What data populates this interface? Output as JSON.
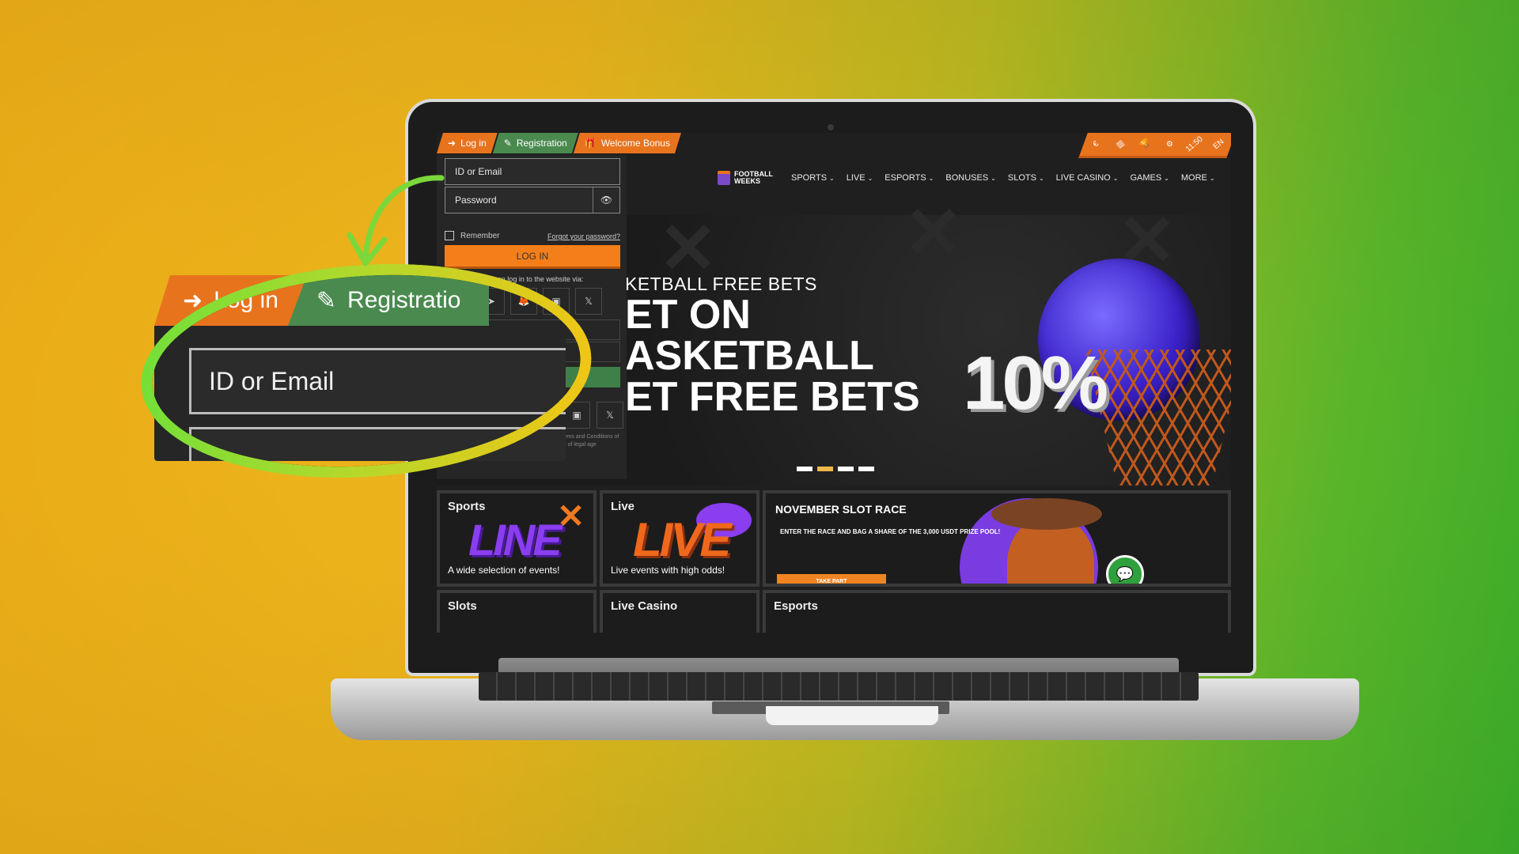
{
  "topbar": {
    "tabs": [
      {
        "label": "Log in",
        "icon": "login-icon"
      },
      {
        "label": "Registration",
        "icon": "edit-icon"
      },
      {
        "label": "Welcome Bonus",
        "icon": "gift-icon"
      }
    ],
    "right_tabs": [
      {
        "label": "€",
        "icon": "currency-icon"
      },
      {
        "label": "📊",
        "icon": "stats-icon"
      },
      {
        "label": "🏆",
        "icon": "trophy-icon"
      },
      {
        "label": "⚙",
        "icon": "settings-icon"
      },
      {
        "label": "11:50",
        "icon": "clock"
      },
      {
        "label": "EN",
        "icon": "language"
      }
    ]
  },
  "nav": {
    "logo_line1": "FOOTBALL",
    "logo_line2": "WEEKS",
    "items": [
      "SPORTS",
      "LIVE",
      "ESPORTS",
      "BONUSES",
      "SLOTS",
      "LIVE CASINO",
      "GAMES",
      "MORE"
    ]
  },
  "login": {
    "id_placeholder": "ID or Email",
    "password_placeholder": "Password",
    "remember_label": "Remember",
    "forgot_label": "Forgot your password?",
    "login_button": "LOG IN",
    "via_label": "You can log in to the website via:",
    "social": [
      "telegram",
      "metamask",
      "twitch",
      "x"
    ],
    "social_glyphs": [
      "➤",
      "🦊",
      "▣",
      "𝕏"
    ],
    "legal_text": "...you confirm that you have read and agree Terms and Conditions of the company and confirm that you are of legal age"
  },
  "hero": {
    "subtitle": "KETBALL FREE BETS",
    "title_line1": "ET ON",
    "title_line2": "ASKETBALL",
    "title_line3": "ET FREE BETS",
    "percent": "10%",
    "slides_total": 4,
    "slide_active": 2
  },
  "cards": [
    {
      "title": "Sports",
      "word": "LINE",
      "desc": "A wide selection of events!"
    },
    {
      "title": "Live",
      "word": "LIVE",
      "desc": "Live events with high odds!"
    },
    {
      "title": "NOVEMBER SLOT RACE",
      "desc": "ENTER THE RACE AND BAG A SHARE OF THE 3,000 USDT PRIZE POOL!",
      "button": "TAKE PART"
    },
    {
      "title": "Slots"
    },
    {
      "title": "Live Casino"
    },
    {
      "title": "Esports"
    }
  ],
  "callout": {
    "tab_login": "Log in",
    "tab_registration": "Registratio",
    "field_label": "ID or Email"
  },
  "colors": {
    "orange": "#e8731d",
    "green": "#4a8a4f",
    "login_button": "#f47f1a",
    "chat": "#2fa03c"
  }
}
